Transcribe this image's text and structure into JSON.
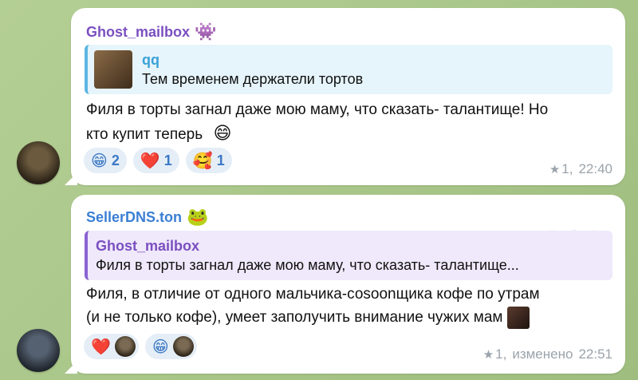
{
  "messages": [
    {
      "sender": "Ghost_mailbox",
      "sender_color": "#7b4fc0",
      "sender_emoji": "👾",
      "reply": {
        "name": "qq",
        "name_color": "#39a2d6",
        "text": "Тем временем держатели тортов",
        "bg": "#e6f4fb",
        "border": "#5cb6e2"
      },
      "text_line1": "Филя в торты загнал даже мою маму, что сказать- талантище! Но",
      "text_line2": "кто купит теперь",
      "text_emoji": "😄",
      "reactions": [
        {
          "emoji": "😁",
          "count": "2"
        },
        {
          "emoji": "❤️",
          "count": "1"
        },
        {
          "emoji": "🥰",
          "count": "1"
        }
      ],
      "meta": {
        "star": "★",
        "views": "1,",
        "time": "22:40"
      }
    },
    {
      "sender": "SellerDNS.ton",
      "sender_color": "#3b7fd4",
      "sender_emoji": "🐸",
      "reply": {
        "name": "Ghost_mailbox",
        "name_color": "#7b4fc0",
        "text": "Филя в торты загнал даже мою маму, что сказать- талантище...",
        "bg": "#efe9fb",
        "border": "#8a63d2"
      },
      "text_line1": "Филя, в отличие от одного мальчика-соsoonщика кофе по утрам",
      "text_line2": "(и не только кофе), умеет заполучить внимание чужих мам",
      "reactions": [
        {
          "emoji": "❤️"
        },
        {
          "emoji": "😁"
        }
      ],
      "meta": {
        "star": "★",
        "views": "1,",
        "edited": "изменено",
        "time": "22:51"
      }
    }
  ]
}
